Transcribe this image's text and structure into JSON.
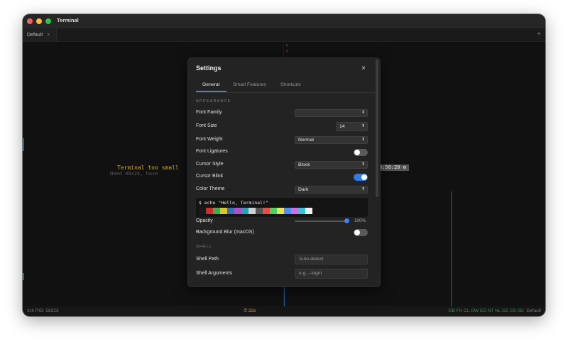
{
  "window": {
    "title": "Terminal"
  },
  "tabs": [
    {
      "label": "Default",
      "close": "×"
    }
  ],
  "add_tab": "+",
  "terminal": {
    "prompt_green": "›",
    "prompt_red": "›",
    "too_small": "Terminal too small",
    "need_text": "Need 80x24, have ",
    "need_highlight": "     ",
    "clock": "3:50:20 ⚙"
  },
  "statusbar": {
    "left": "zsh  PID: 58223",
    "middle": "⏱ 22s",
    "right_green": "GB  FH  CL  GW  ED  NT  NL  CE  CS  SD",
    "right": "Default"
  },
  "settings": {
    "title": "Settings",
    "close": "×",
    "tabs": [
      "General",
      "Smart Features",
      "Shortcuts"
    ],
    "appearance_section": "APPEARANCE",
    "font_family": {
      "label": "Font Family",
      "value": ""
    },
    "font_size": {
      "label": "Font Size",
      "value": "14"
    },
    "font_weight": {
      "label": "Font Weight",
      "value": "Normal"
    },
    "font_ligatures": {
      "label": "Font Ligatures",
      "enabled": false
    },
    "cursor_style": {
      "label": "Cursor Style",
      "value": "Block"
    },
    "cursor_blink": {
      "label": "Cursor Blink",
      "enabled": true
    },
    "color_theme": {
      "label": "Color Theme",
      "value": "Dark"
    },
    "preview": {
      "text": "$ echo \"Hello, Terminal!\"",
      "swatches": [
        "#1a1a1a",
        "#c9302c",
        "#3fae49",
        "#d6c92f",
        "#3570c6",
        "#b14fc6",
        "#2aa1b3",
        "#d0d0d0",
        "#555555",
        "#ef4a43",
        "#4fd160",
        "#f0e34a",
        "#4f8ff0",
        "#d36be6",
        "#3ac3d6",
        "#f0f0f0"
      ]
    },
    "opacity": {
      "label": "Opacity",
      "value": "100%",
      "fraction": 1.0
    },
    "background_blur": {
      "label": "Background Blur (macOS)",
      "enabled": false
    },
    "shell_section": "SHELL",
    "shell_path": {
      "label": "Shell Path",
      "placeholder": "Auto-detect"
    },
    "shell_args": {
      "label": "Shell Arguments",
      "placeholder": "e.g. --login"
    }
  }
}
